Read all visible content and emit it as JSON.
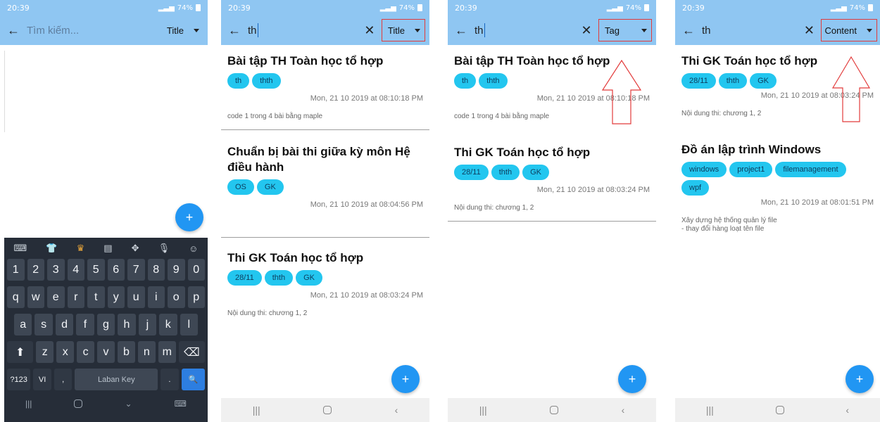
{
  "status": {
    "time": "20:39",
    "battery": "74%"
  },
  "icons": {
    "back": "arrow-left-icon",
    "clear": "close-icon",
    "caret": "caret-down-icon",
    "fab": "plus-icon",
    "nav_recents": "recents-icon",
    "nav_home": "home-icon",
    "nav_back": "back-chevron-icon"
  },
  "colors": {
    "appbar": "#8fc6f2",
    "tag": "#23c6ef",
    "fab": "#2196f3",
    "highlight_box": "#e23b3b",
    "keyboard": "#262d38"
  },
  "screen1": {
    "search_placeholder": "Tìm kiếm...",
    "filter": "Title",
    "fab": "+",
    "keyboard": {
      "number_row": [
        "1",
        "2",
        "3",
        "4",
        "5",
        "6",
        "7",
        "8",
        "9",
        "0"
      ],
      "row1": [
        "q",
        "w",
        "e",
        "r",
        "t",
        "y",
        "u",
        "i",
        "o",
        "p"
      ],
      "row2": [
        "a",
        "s",
        "d",
        "f",
        "g",
        "h",
        "j",
        "k",
        "l"
      ],
      "row3": [
        "z",
        "x",
        "c",
        "v",
        "b",
        "n",
        "m"
      ],
      "symbols_key": "?123",
      "lang_key": "VI",
      "comma_key": ",",
      "space_label": "Laban Key",
      "period_key": "."
    }
  },
  "screen2": {
    "search_value": "th",
    "filter": "Title",
    "fab": "+",
    "notes": [
      {
        "title": "Bài tập TH Toàn học tổ hợp",
        "tags": [
          "th",
          "thth"
        ],
        "date": "Mon, 21 10 2019 at 08:10:18 PM",
        "content": "code 1 trong 4 bài bằng maple"
      },
      {
        "title": "Chuẩn bị bài thi giữa kỳ môn Hệ điều hành",
        "tags": [
          "OS",
          "GK"
        ],
        "date": "Mon, 21 10 2019 at 08:04:56 PM",
        "content": ""
      },
      {
        "title": "Thi GK Toán học tổ hợp",
        "tags": [
          "28/11",
          "thth",
          "GK"
        ],
        "date": "Mon, 21 10 2019 at 08:03:24 PM",
        "content": "Nội dung thi: chương 1, 2"
      }
    ]
  },
  "screen3": {
    "search_value": "th",
    "filter": "Tag",
    "fab": "+",
    "notes": [
      {
        "title": "Bài tập TH Toàn học tổ hợp",
        "tags": [
          "th",
          "thth"
        ],
        "date": "Mon, 21 10 2019 at 08:10:18 PM",
        "content": "code 1 trong 4 bài bằng maple"
      },
      {
        "title": "Thi GK Toán học tổ hợp",
        "tags": [
          "28/11",
          "thth",
          "GK"
        ],
        "date": "Mon, 21 10 2019 at 08:03:24 PM",
        "content": "Nội dung thi: chương 1, 2"
      }
    ]
  },
  "screen4": {
    "search_value": "th",
    "filter": "Content",
    "fab": "+",
    "notes": [
      {
        "title": "Thi GK Toán học tổ hợp",
        "tags": [
          "28/11",
          "thth",
          "GK"
        ],
        "date": "Mon, 21 10 2019 at 08:03:24 PM",
        "content": "Nội dung thi: chương 1, 2"
      },
      {
        "title": "Đồ án lập trình Windows",
        "tags": [
          "windows",
          "project1",
          "filemanagement",
          "wpf"
        ],
        "date": "Mon, 21 10 2019 at 08:01:51 PM",
        "content": "Xây dựng hệ thống quản lý file\n- thay đổi hàng loạt tên file"
      }
    ]
  }
}
